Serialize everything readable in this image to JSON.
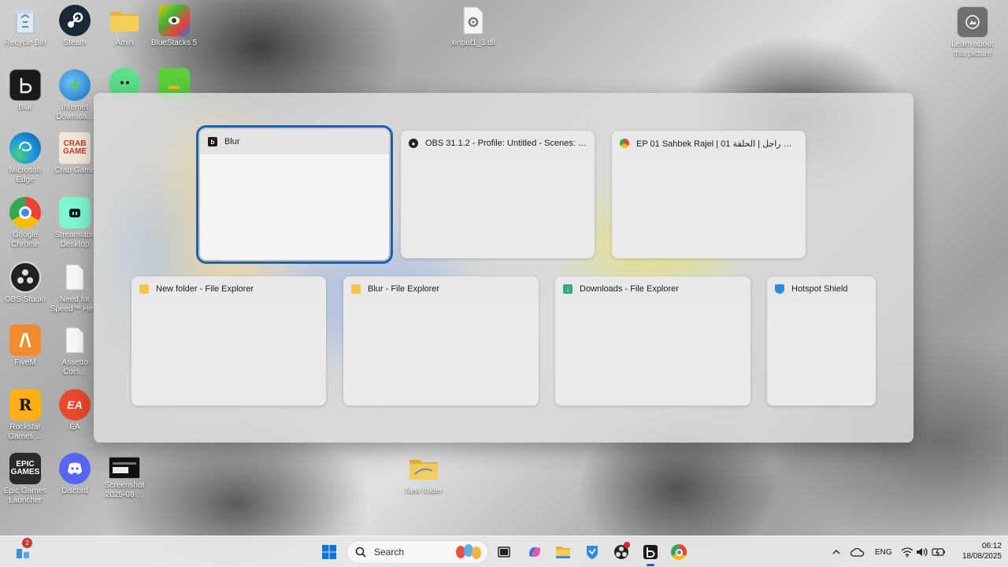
{
  "desktop": {
    "icons": [
      {
        "label": "Recycle Bin"
      },
      {
        "label": "Steam"
      },
      {
        "label": "Amin"
      },
      {
        "label": "BlueStacks 5"
      },
      {
        "label": "xinput1_3.dll"
      },
      {
        "label": "Learn about this picture"
      },
      {
        "label": "Blur"
      },
      {
        "label": "Internet Downloa..."
      },
      {
        "label": "Microsoft Edge"
      },
      {
        "label": "Crab Game"
      },
      {
        "label": "Google Chrome"
      },
      {
        "label": "Streamlabs Desktop"
      },
      {
        "label": "OBS Studio"
      },
      {
        "label": "Need for Speed™ He..."
      },
      {
        "label": "FiveM"
      },
      {
        "label": "Assetto Cors..."
      },
      {
        "label": "Rockstar Games ..."
      },
      {
        "label": "EA"
      },
      {
        "label": "Epic Games Launcher"
      },
      {
        "label": "Discord"
      },
      {
        "label": "Screenshot 2025-08-..."
      },
      {
        "label": "New folder"
      }
    ]
  },
  "switcher": {
    "windows": [
      {
        "title": "Blur",
        "icon": "blur-app-icon",
        "selected": true
      },
      {
        "title": "OBS 31.1.2 - Profile: Untitled - Scenes: Razor_...",
        "icon": "obs-icon"
      },
      {
        "title": "EP 01 Sahbek Rajel | صاحبك راجل | الحلقة 01 |...",
        "icon": "chrome-icon"
      },
      {
        "title": "New folder - File Explorer",
        "icon": "folder-icon"
      },
      {
        "title": "Blur - File Explorer",
        "icon": "folder-icon"
      },
      {
        "title": "Downloads - File Explorer",
        "icon": "downloads-folder-icon"
      },
      {
        "title": "Hotspot Shield",
        "icon": "hotspot-shield-icon"
      }
    ]
  },
  "taskbar": {
    "widgets_badge": "2",
    "search_placeholder": "Search",
    "language": "ENG",
    "time": "06:12",
    "date": "18/08/2025"
  },
  "colors": {
    "selection_outline": "#1f5fb4",
    "taskbar_bg": "#e6e8ea"
  }
}
